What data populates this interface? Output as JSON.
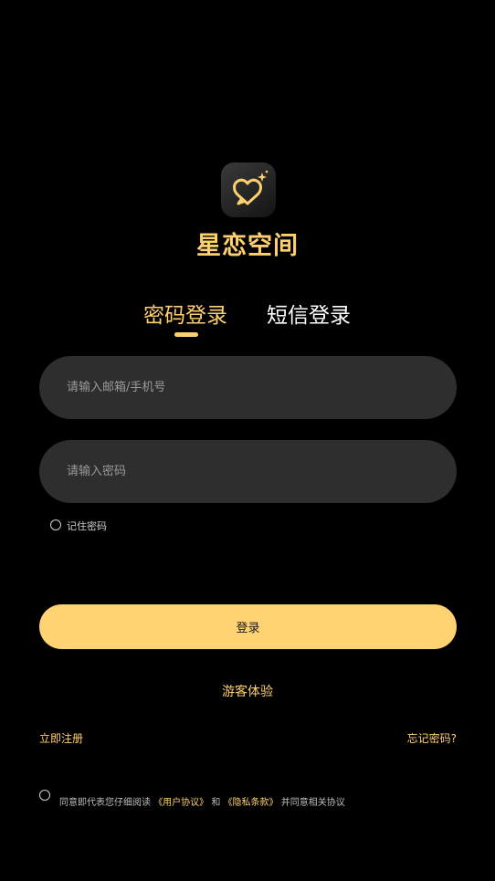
{
  "app": {
    "name": "星恋空间",
    "logo_icon": "heart-chat-sparkle-icon"
  },
  "tabs": [
    {
      "label": "密码登录",
      "active": true
    },
    {
      "label": "短信登录",
      "active": false
    }
  ],
  "form": {
    "account_placeholder": "请输入邮箱/手机号",
    "password_placeholder": "请输入密码",
    "remember_label": "记住密码",
    "remember_checked": false
  },
  "actions": {
    "login_label": "登录",
    "guest_label": "游客体验",
    "register_label": "立即注册",
    "forgot_label": "忘记密码?"
  },
  "agreement": {
    "checked": false,
    "prefix": "同意即代表您仔细阅读 ",
    "user_agreement": "《用户协议》",
    "and": " 和 ",
    "privacy": "《隐私条款》",
    "suffix": " 并同意相关协议"
  },
  "colors": {
    "accent": "#ffd070",
    "background": "#000000",
    "input_bg": "#2e2e2e",
    "button_bg": "#ffd272"
  }
}
